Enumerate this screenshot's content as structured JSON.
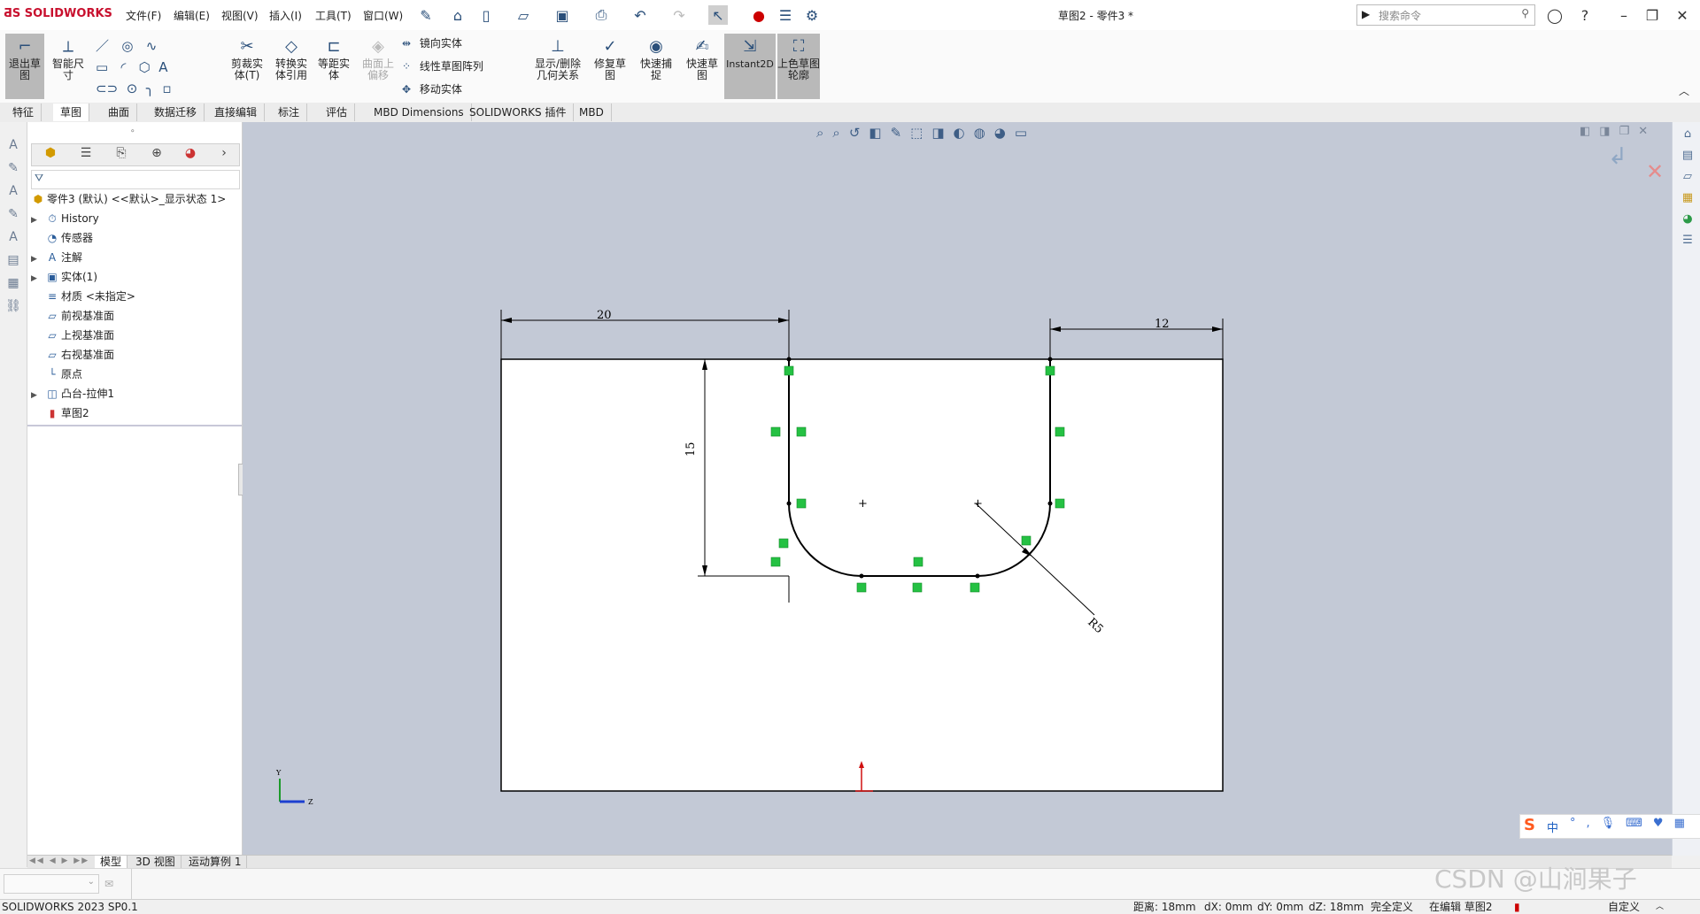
{
  "app": {
    "logo": "SOLIDWORKS",
    "doc_title": "草图2 - 零件3 *"
  },
  "menu": [
    "文件(F)",
    "编辑(E)",
    "视图(V)",
    "插入(I)",
    "工具(T)",
    "窗口(W)"
  ],
  "search": {
    "placeholder": "搜索命令"
  },
  "commands": {
    "exit_sketch": "退出草图",
    "smart_dim": "智能尺寸",
    "trim": "剪裁实体(T)",
    "convert": "转换实体引用",
    "offset": "等距实体",
    "surface_offset": "曲面上偏移",
    "mirror": "镜向实体",
    "linear_pattern": "线性草图阵列",
    "move": "移动实体",
    "show_relations": "显示/删除几何关系",
    "repair": "修复草图",
    "quick_snap": "快速捕捉",
    "rapid_sketch": "快速草图",
    "instant2d": "Instant2D",
    "shaded": "上色草图轮廓"
  },
  "tabs": [
    "特征",
    "草图",
    "曲面",
    "数据迁移",
    "直接编辑",
    "标注",
    "评估",
    "MBD Dimensions",
    "SOLIDWORKS 插件",
    "MBD"
  ],
  "active_tab": "草图",
  "tree": {
    "root": "零件3 (默认) <<默认>_显示状态 1>",
    "items": [
      "History",
      "传感器",
      "注解",
      "实体(1)",
      "材质 <未指定>",
      "前视基准面",
      "上视基准面",
      "右视基准面",
      "原点",
      "凸台-拉伸1",
      "草图2"
    ]
  },
  "sketch": {
    "dim_left": "20",
    "dim_right": "12",
    "dim_height": "15",
    "dim_radius": "R5"
  },
  "triad": {
    "y": "Y",
    "z": "Z"
  },
  "bottom_tabs": [
    "模型",
    "3D 视图",
    "运动算例 1"
  ],
  "status": {
    "version": "SOLIDWORKS 2023 SP0.1",
    "distance": "距离: 18mm",
    "dx": "dX: 0mm",
    "dy": "dY: 0mm",
    "dz": "dZ: 18mm",
    "defined": "完全定义",
    "editing": "在编辑 草图2",
    "custom": "自定义"
  },
  "ime": {
    "label": "中"
  },
  "watermark": "CSDN @山涧果子"
}
